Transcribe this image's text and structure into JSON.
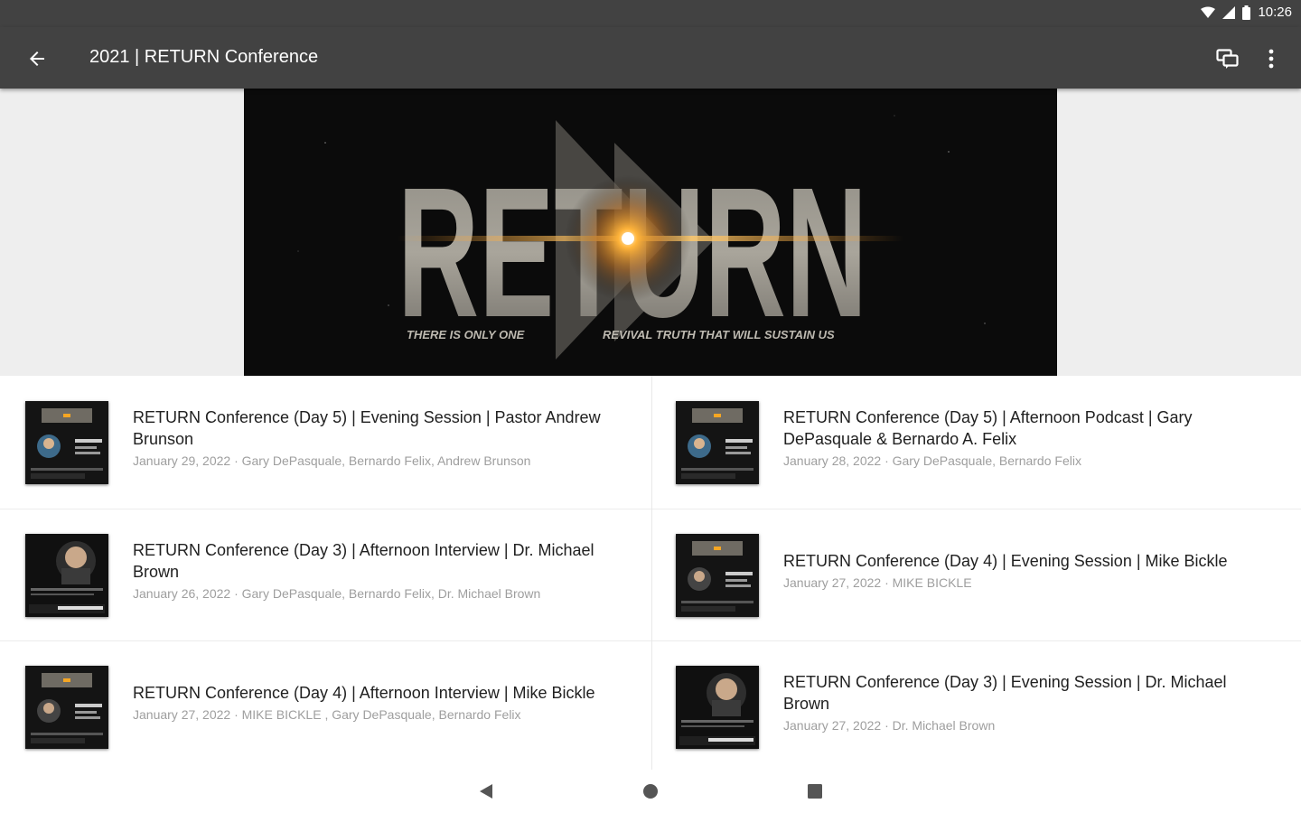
{
  "status_bar": {
    "time": "10:26"
  },
  "app_bar": {
    "title": "2021 | RETURN Conference",
    "back_icon": "arrow-back-icon",
    "cast_icon": "cast-icon",
    "more_icon": "more-vertical-icon"
  },
  "hero": {
    "title": "RETURN",
    "tagline_left": "THERE IS ONLY ONE",
    "tagline_right": "REVIVAL TRUTH THAT WILL SUSTAIN US"
  },
  "episodes": [
    {
      "title": "RETURN Conference (Day 5) | Evening Session  | Pastor Andrew Brunson",
      "meta": "January 29, 2022 · Gary DePasquale, Bernardo Felix, Andrew Brunson"
    },
    {
      "title": "RETURN Conference (Day 5) | Afternoon Podcast | Gary DePasquale & Bernardo A. Felix",
      "meta": "January 28, 2022 · Gary DePasquale, Bernardo Felix"
    },
    {
      "title": "RETURN Conference (Day 3) | Afternoon Interview | Dr. Michael Brown",
      "meta": "January 26, 2022 · Gary DePasquale, Bernardo Felix, Dr. Michael Brown"
    },
    {
      "title": "RETURN Conference (Day 4) | Evening Session | Mike Bickle",
      "meta": "January 27, 2022 · MIKE BICKLE"
    },
    {
      "title": "RETURN Conference (Day 4) | Afternoon Interview | Mike Bickle",
      "meta": "January 27, 2022 · MIKE BICKLE , Gary DePasquale, Bernardo Felix"
    },
    {
      "title": "RETURN Conference (Day 3) | Evening Session | Dr. Michael Brown",
      "meta": "January 27, 2022 · Dr. Michael Brown"
    }
  ],
  "colors": {
    "app_bar": "#424242",
    "title_text": "#212121",
    "meta_text": "#9e9e9e",
    "hero_accent": "#f5a623"
  },
  "nav_bar": {
    "back_icon": "nav-back-icon",
    "home_icon": "nav-home-icon",
    "recents_icon": "nav-recents-icon"
  }
}
